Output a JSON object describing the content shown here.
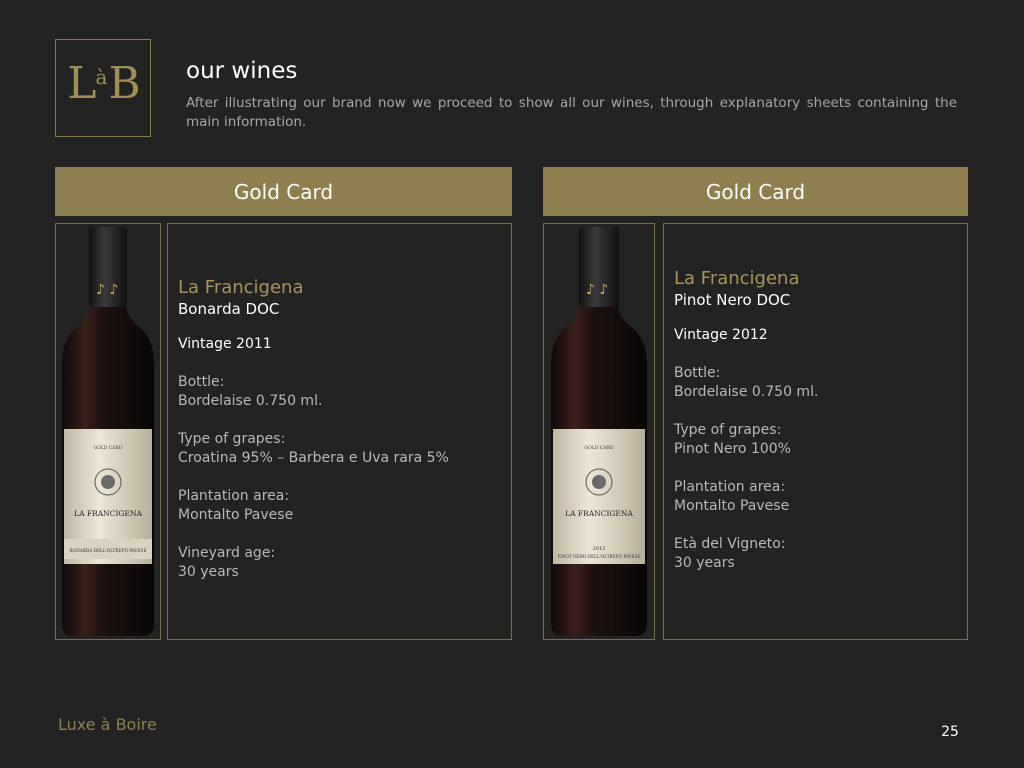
{
  "logo": {
    "letter_left": "L",
    "letter_mid": "à",
    "letter_right": "B"
  },
  "header": {
    "title": "our wines",
    "intro": "After illustrating our brand now we proceed to show all our wines, through explanatory sheets containing the main information."
  },
  "cards": [
    {
      "banner": "Gold Card",
      "name": "La Francigena",
      "type": "Bonarda DOC",
      "vintage": "Vintage  2011",
      "bottle_label": "Bottle:",
      "bottle_value": "Bordelaise 0.750 ml.",
      "grapes_label": "Type of grapes:",
      "grapes_value": "Croatina 95% – Barbera e Uva rara 5%",
      "area_label": "Plantation area:",
      "area_value": "Montalto Pavese",
      "age_label": "Vineyard age:",
      "age_value": "30 years",
      "bottle_image": {
        "label_top": "GOLD CARD",
        "label_name": "LA FRANCIGENA",
        "label_bottom": "BONARDA DELL'OLTREPÒ PAVESE"
      }
    },
    {
      "banner": "Gold Card",
      "name": "La Francigena",
      "type": "Pinot Nero DOC",
      "vintage": "Vintage 2012",
      "bottle_label": "Bottle:",
      "bottle_value": "Bordelaise 0.750 ml.",
      "grapes_label": "Type of grapes:",
      "grapes_value": "Pinot Nero 100%",
      "area_label": "Plantation area:",
      "area_value": "Montalto Pavese",
      "age_label": "Età del Vigneto:",
      "age_value": "30 years",
      "bottle_image": {
        "label_top": "GOLD CARD",
        "label_name": "LA FRANCIGENA",
        "label_year": "2012",
        "label_bottom": "PINOT NERO DELL'OLTREPÒ PAVESE"
      }
    }
  ],
  "footer": {
    "brand": "Luxe à Boire",
    "page": "25"
  },
  "colors": {
    "background": "#232323",
    "gold": "#8e7f4e",
    "accent_text": "#a89359",
    "border": "#7a6c44"
  }
}
